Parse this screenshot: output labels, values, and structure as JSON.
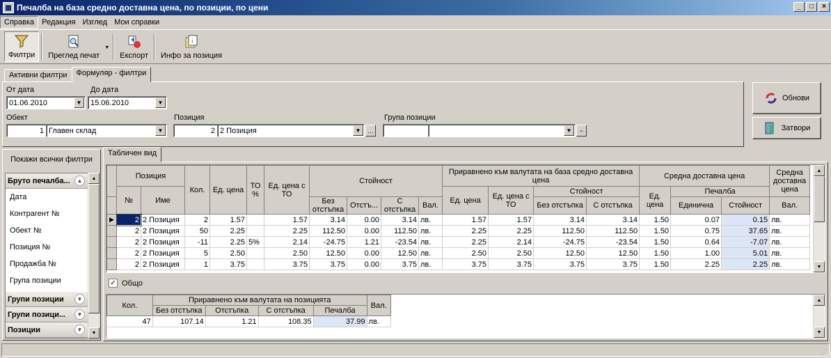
{
  "window": {
    "title": "Печалба на база средно доставна цена, по позиции, по цени"
  },
  "menu": [
    "Справка",
    "Редакция",
    "Изглед",
    "Мои справки"
  ],
  "toolbar": {
    "filters": "Филтри",
    "print_preview": "Преглед печат",
    "export": "Експорт",
    "item_info": "Инфо за позиция"
  },
  "filter_tabs": {
    "active": "Активни филтри",
    "form": "Формуляр - филтри"
  },
  "filters": {
    "from_date_label": "От дата",
    "from_date": "01.06.2010",
    "to_date_label": "До дата",
    "to_date": "15.06.2010",
    "object_label": "Обект",
    "object_id": "1",
    "object_name": "Главен склад",
    "item_label": "Позиция",
    "item_id": "2",
    "item_name": "2 Позиция",
    "group_label": "Група позиции",
    "group_id": "",
    "group_name": ""
  },
  "buttons": {
    "refresh": "Обнови",
    "close": "Затвори"
  },
  "sidebar": {
    "show_all": "Покажи всички филтри",
    "group_main": "Бруто печалба...",
    "items": [
      "Дата",
      "Контрагент №",
      "Обект №",
      "Позиция №",
      "Продажба №",
      "Група позиции"
    ],
    "groups": [
      "Групи позиции",
      "Групи позици...",
      "Позиции"
    ]
  },
  "view_tab": "Табличен вид",
  "main_table": {
    "headers": {
      "position": "Позиция",
      "no": "№",
      "name": "Име",
      "qty": "Кол.",
      "unit_price": "Ед. цена",
      "discount_pct": "ТО %",
      "unit_price_to": "Ед. цена с ТО",
      "value": "Стойност",
      "no_discount": "Без отстъпка",
      "discount": "Отстъ...",
      "with_discount": "С отстъпка",
      "currency": "Вал.",
      "converted": "Приравнено към валутата на база средно доставна цена",
      "conv_unit_price": "Ед. цена",
      "conv_unit_price_to": "Ед. цена с ТО",
      "conv_value": "Стойност",
      "conv_no_discount": "Без отстъпка",
      "conv_with_discount": "С отстъпка",
      "avg_cost": "Средна доставна цена",
      "avg_unit": "Ед. цена",
      "profit": "Печалба",
      "profit_unit": "Единична",
      "profit_value": "Стойност",
      "avg_currency": "Средна доставна цена",
      "avg_currency_sub": "Вал."
    },
    "rows": [
      {
        "no": "2",
        "name": "2 Позиция",
        "qty": "2",
        "price": "1.57",
        "to": "",
        "price_to": "1.57",
        "no_disc": "3.14",
        "disc": "0.00",
        "with_disc": "3.14",
        "cur": "лв.",
        "c_price": "1.57",
        "c_price_to": "1.57",
        "c_no_disc": "3.14",
        "c_with_disc": "3.14",
        "avg": "1.50",
        "p_unit": "0.07",
        "p_value": "0.15",
        "cur2": "лв."
      },
      {
        "no": "2",
        "name": "2 Позиция",
        "qty": "50",
        "price": "2.25",
        "to": "",
        "price_to": "2.25",
        "no_disc": "112.50",
        "disc": "0.00",
        "with_disc": "112.50",
        "cur": "лв.",
        "c_price": "2.25",
        "c_price_to": "2.25",
        "c_no_disc": "112.50",
        "c_with_disc": "112.50",
        "avg": "1.50",
        "p_unit": "0.75",
        "p_value": "37.65",
        "cur2": "лв."
      },
      {
        "no": "2",
        "name": "2 Позиция",
        "qty": "-11",
        "price": "2.25",
        "to": "5%",
        "price_to": "2.14",
        "no_disc": "-24.75",
        "disc": "1.21",
        "with_disc": "-23.54",
        "cur": "лв.",
        "c_price": "2.25",
        "c_price_to": "2.14",
        "c_no_disc": "-24.75",
        "c_with_disc": "-23.54",
        "avg": "1.50",
        "p_unit": "0.64",
        "p_value": "-7.07",
        "cur2": "лв."
      },
      {
        "no": "2",
        "name": "2 Позиция",
        "qty": "5",
        "price": "2.50",
        "to": "",
        "price_to": "2.50",
        "no_disc": "12.50",
        "disc": "0.00",
        "with_disc": "12.50",
        "cur": "лв.",
        "c_price": "2.50",
        "c_price_to": "2.50",
        "c_no_disc": "12.50",
        "c_with_disc": "12.50",
        "avg": "1.50",
        "p_unit": "1.00",
        "p_value": "5.01",
        "cur2": "лв."
      },
      {
        "no": "2",
        "name": "2 Позиция",
        "qty": "1",
        "price": "3.75",
        "to": "",
        "price_to": "3.75",
        "no_disc": "3.75",
        "disc": "0.00",
        "with_disc": "3.75",
        "cur": "лв.",
        "c_price": "3.75",
        "c_price_to": "3.75",
        "c_no_disc": "3.75",
        "c_with_disc": "3.75",
        "avg": "1.50",
        "p_unit": "2.25",
        "p_value": "2.25",
        "cur2": "лв."
      }
    ]
  },
  "total": {
    "checkbox_label": "Общо",
    "headers": {
      "qty": "Кол.",
      "converted": "Приравнено към валутата на позицията",
      "no_discount": "Без отстъпка",
      "discount": "Отстъпка",
      "with_discount": "С отстъпка",
      "profit": "Печалба",
      "currency": "Вал."
    },
    "row": {
      "qty": "47",
      "no_disc": "107.14",
      "disc": "1.21",
      "with_disc": "108.35",
      "profit": "37.99",
      "cur": "лв."
    }
  }
}
